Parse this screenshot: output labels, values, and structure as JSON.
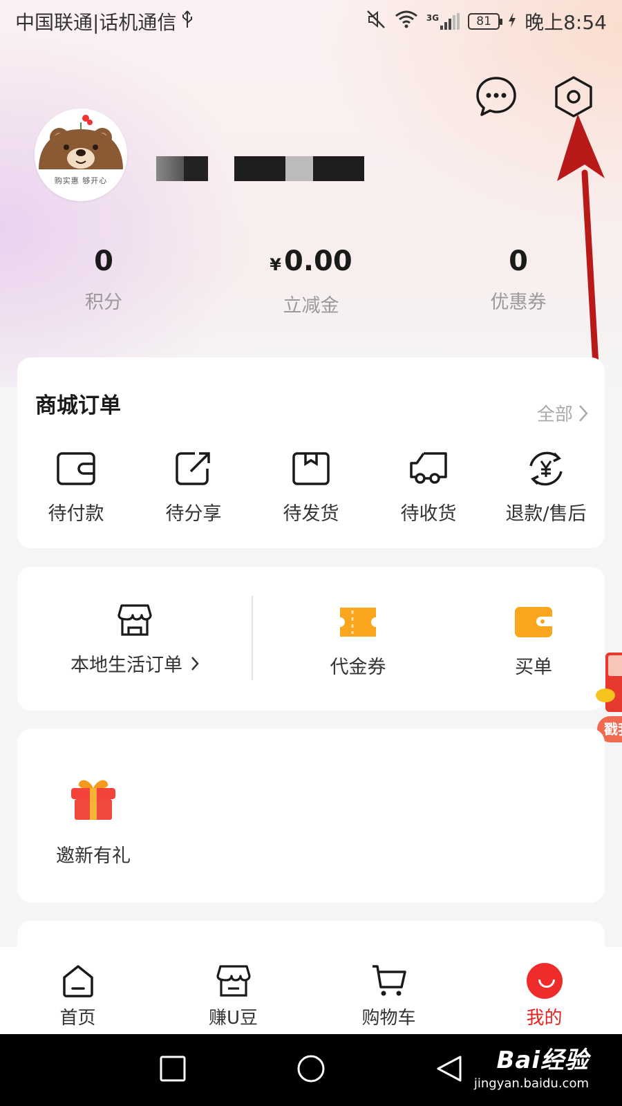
{
  "status_bar": {
    "carrier": "中国联通|话机通信",
    "network": "3G",
    "battery": "81",
    "time": "晚上8:54"
  },
  "profile": {
    "avatar_slogan": "购实惠 够开心"
  },
  "stats": [
    {
      "value": "0",
      "label": "积分"
    },
    {
      "currency": "¥",
      "value": "0.00",
      "label": "立减金"
    },
    {
      "value": "0",
      "label": "优惠券"
    }
  ],
  "orders": {
    "title": "商城订单",
    "all_label": "全部",
    "items": [
      {
        "label": "待付款",
        "icon": "wallet-icon"
      },
      {
        "label": "待分享",
        "icon": "share-icon"
      },
      {
        "label": "待发货",
        "icon": "package-icon"
      },
      {
        "label": "待收货",
        "icon": "truck-icon"
      },
      {
        "label": "退款/售后",
        "icon": "refund-icon"
      }
    ]
  },
  "services": {
    "local_orders_label": "本地生活订单",
    "items": [
      {
        "label": "代金券",
        "icon": "voucher-icon"
      },
      {
        "label": "买单",
        "icon": "pay-bill-icon"
      }
    ]
  },
  "invite": {
    "label": "邀新有礼",
    "icon": "gift-icon"
  },
  "floater": {
    "label": "戳我"
  },
  "tabbar": {
    "items": [
      {
        "label": "首页",
        "icon": "home-icon"
      },
      {
        "label": "赚U豆",
        "icon": "shop-icon"
      },
      {
        "label": "购物车",
        "icon": "cart-icon"
      },
      {
        "label": "我的",
        "icon": "me-icon",
        "active": true
      }
    ]
  },
  "watermark": {
    "main": "Bai经验",
    "sub": "jingyan.baidu.com"
  },
  "colors": {
    "accent_red": "#e8231f",
    "voucher_orange": "#f9a51e",
    "annotation_arrow": "#b81a1a"
  }
}
